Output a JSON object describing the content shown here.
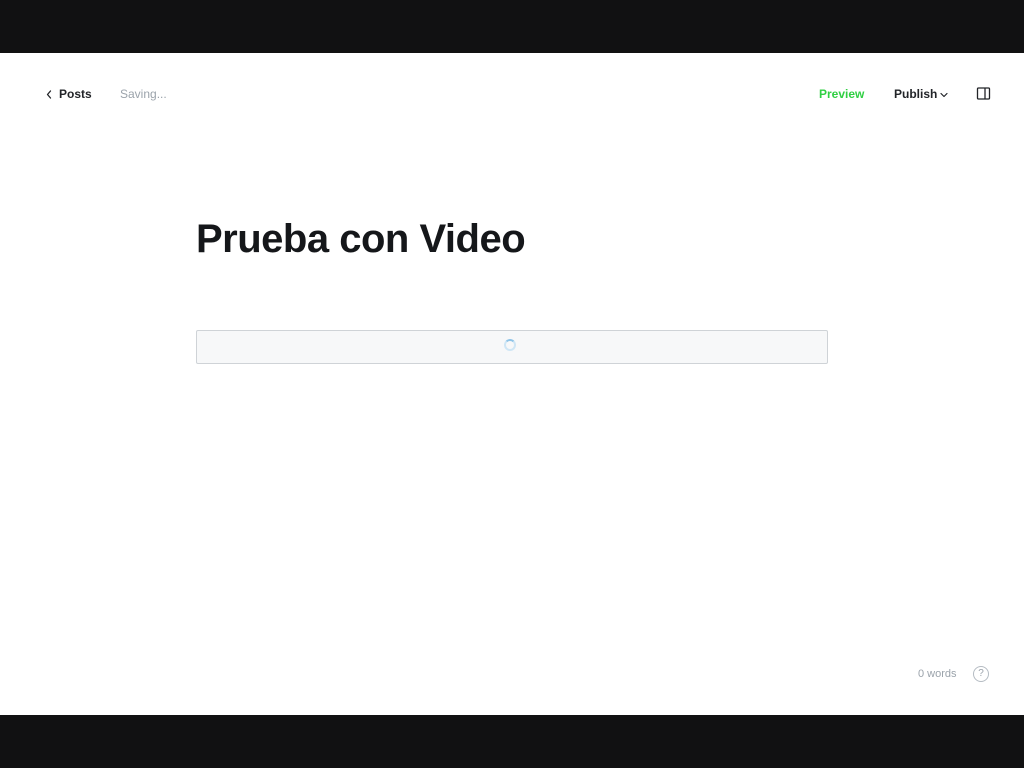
{
  "header": {
    "back_label": "Posts",
    "save_status": "Saving...",
    "preview_label": "Preview",
    "publish_label": "Publish"
  },
  "post": {
    "title": "Prueba con Video"
  },
  "footer": {
    "word_count": "0 words",
    "help_label": "?"
  },
  "colors": {
    "accent": "#30cf43",
    "text_primary": "#15171a",
    "text_muted": "#9ba3ab",
    "letterbox": "#111112"
  },
  "icons": [
    "chevron-left-icon",
    "chevron-down-icon",
    "sidebar-icon",
    "loading-spinner-icon",
    "question-icon"
  ]
}
